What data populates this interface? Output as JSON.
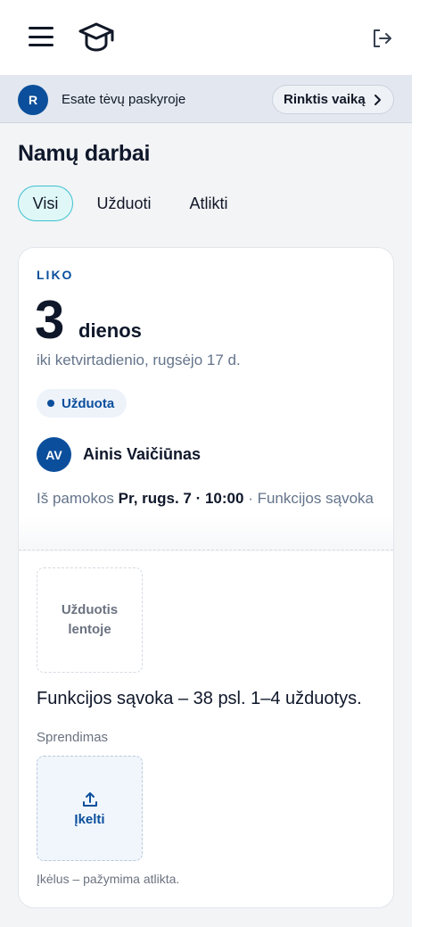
{
  "header": {
    "menu_icon": "hamburger-menu-icon",
    "logo_icon": "graduation-cap-icon",
    "logout_icon": "logout-icon"
  },
  "banner": {
    "avatar_initial": "R",
    "text": "Esate tėvų paskyroje",
    "choose_child_label": "Rinktis vaiką"
  },
  "page": {
    "title": "Namų darbai"
  },
  "tabs": [
    {
      "label": "Visi",
      "active": true
    },
    {
      "label": "Užduoti",
      "active": false
    },
    {
      "label": "Atlikti",
      "active": false
    }
  ],
  "homework": {
    "left_label": "LIKO",
    "days_count": "3",
    "days_word": "dienos",
    "deadline_text": "iki ketvirtadienio, rugsėjo 17 d.",
    "status": "Užduota",
    "teacher_initials": "AV",
    "teacher_name": "Ainis Vaičiūnas",
    "lesson_prefix": "Iš pamokos",
    "lesson_time": "Pr, rugs. 7 · 10:00",
    "lesson_topic": "· Funkcijos sąvoka",
    "board_task_label": "Užduotis lentoje",
    "task_description": "Funkcijos sąvoka – 38 psl. 1–4 užduotys.",
    "solution_label": "Sprendimas",
    "upload_label": "Įkelti",
    "upload_note": "Įkėlus – pažymima atlikta."
  },
  "colors": {
    "brand": "#0b4f9c",
    "active_tab_border": "#3cc1cf",
    "active_tab_bg": "#e0f7f8"
  }
}
